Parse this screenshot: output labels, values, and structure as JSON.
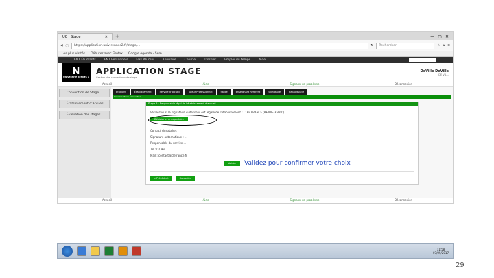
{
  "browser": {
    "tab_title": "UC | Stage",
    "new_tab": "+",
    "url": "https://application.univ-rennes2.fr/stage/...",
    "search_placeholder": "Rechercher",
    "bookmarks": [
      "Les plus visités",
      "Débuter avec Firefox",
      "Google Agenda - Sem"
    ]
  },
  "ent_nav": [
    "ENT Étudiants",
    "ENT Personnels",
    "ENT Alumni",
    "Annuaire",
    "Courriel",
    "Dossier",
    "Emploi du temps",
    "Aide"
  ],
  "banner": {
    "logo_letter": "N",
    "logo_sub": "UNIVERSITÉ RENNES 2",
    "title": "APPLICATION STAGE",
    "subtitle": "Gestion des conventions de stage",
    "user_name": "DeVille DeVille",
    "user_sub": "DE VIL..."
  },
  "top_nav": {
    "accueil": "Accueil",
    "aide": "Aide",
    "signaler": "Signaler un problème",
    "deconnexion": "Déconnexion"
  },
  "sidebar": [
    "Convention de Stage",
    "Établissement d'Accueil",
    "Évaluation des stages"
  ],
  "steps": [
    "Étudiant",
    "Établissement",
    "Service d'accueil",
    "Tuteur Professionnel",
    "Stage",
    "Enseignant Référent",
    "Signataire",
    "Récapitulatif"
  ],
  "greenbar": "Création d'une convention",
  "panel": {
    "header": "Étape 3 : Responsable légal de l'établissement d'accueil",
    "line1": "Vérifiez ici si la signataire ci-dessous est légale de l'établissement : CLEF FRANCE (RENNE 35000)",
    "desist_button": "Désister et en répertoire",
    "contact_label": "Contact signataire :",
    "contact_lines": [
      "Signature automatique : ...",
      "Responsable du service ...",
      "Tél : 02 99 ...",
      "Mail : contact@clefrance.fr"
    ],
    "validate_button": "Valider",
    "note": "Validez pour confirmer votre choix",
    "prev_button": "< Précédent",
    "next_button": "Suivant >"
  },
  "taskbar": {
    "time": "11:58",
    "date": "07/09/2017"
  },
  "slide": {
    "page_number": "29"
  }
}
